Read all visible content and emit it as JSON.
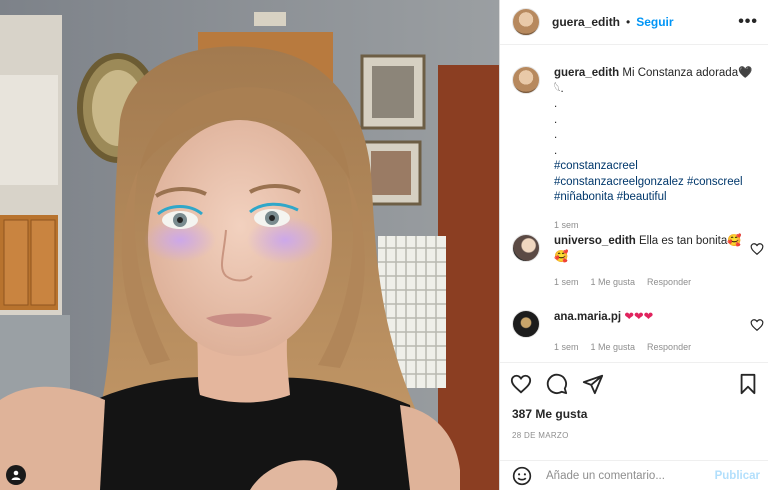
{
  "post": {
    "username": "guera_edith",
    "follow_label": "Seguir",
    "more_label": "•••",
    "photo_alt": "Selfie with purple glitter makeup"
  },
  "caption": {
    "username": "guera_edith",
    "text": "Mi Constanza adorada🖤𓆩.",
    "dots": [
      ".",
      ".",
      ".",
      "."
    ],
    "hashtags_line1": [
      "#constanzacreel"
    ],
    "hashtags_line2": [
      "#constanzacreelgonzalez",
      "#conscreel"
    ],
    "hashtags_line3": [
      "#niñabonita",
      "#beautiful"
    ],
    "time": "1 sem"
  },
  "comments": [
    {
      "username": "universo_edith",
      "text": "Ella es tan bonita🥰",
      "text2": "🥰",
      "time": "1 sem",
      "likes": "1 Me gusta",
      "reply": "Responder"
    },
    {
      "username": "ana.maria.pj",
      "text": "❤❤❤",
      "time": "1 sem",
      "likes": "1 Me gusta",
      "reply": "Responder"
    }
  ],
  "stats": {
    "likes": "387 Me gusta",
    "date": "28 DE MARZO"
  },
  "composer": {
    "placeholder": "Añade un comentario...",
    "publish": "Publicar"
  },
  "icons": [
    "heart-icon",
    "comment-icon",
    "share-icon",
    "bookmark-icon",
    "emoji-icon",
    "user-tag-icon"
  ],
  "colors": {
    "link": "#0095f6",
    "hashtag": "#00376b",
    "muted": "#8e8e8e",
    "publish_disabled": "#b2dffc"
  }
}
